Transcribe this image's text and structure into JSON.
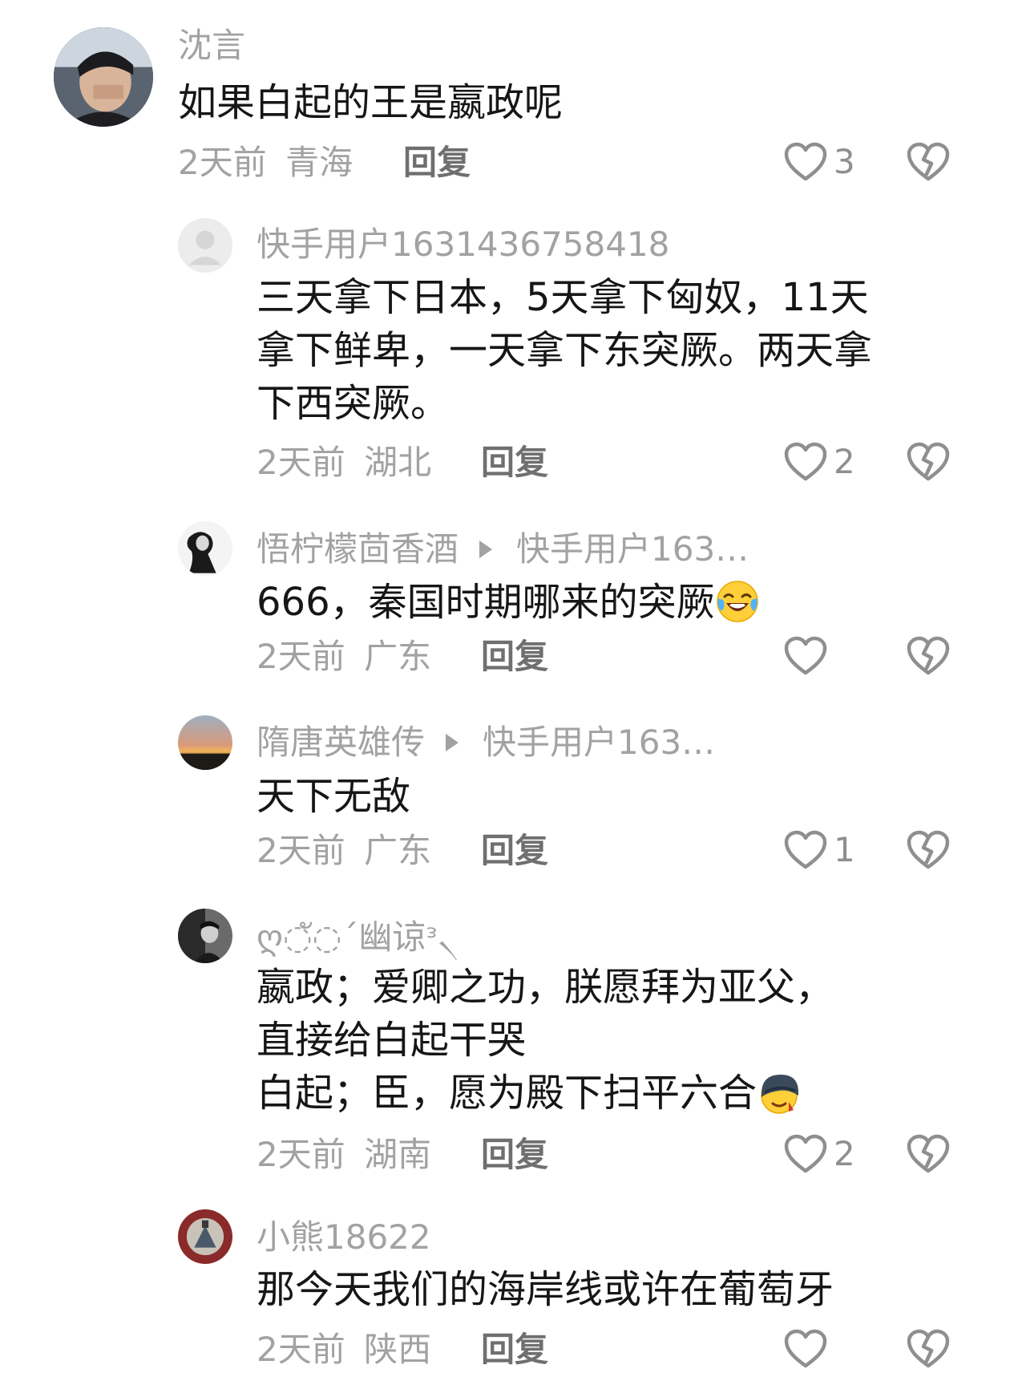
{
  "comments": [
    {
      "username": "沈言",
      "lines": [
        "如果白起的王是嬴政呢"
      ],
      "time": "2天前",
      "location": "青海",
      "reply_label": "回复",
      "likes": "3"
    },
    {
      "username": "快手用户1631436758418",
      "lines": [
        "三天拿下日本，5天拿下匈奴，11天",
        "拿下鲜卑，一天拿下东突厥。两天拿",
        "下西突厥。"
      ],
      "time": "2天前",
      "location": "湖北",
      "reply_label": "回复",
      "likes": "2"
    },
    {
      "username": "悟柠檬茴香酒",
      "reply_to": "快手用户163…",
      "lines": [
        "666，秦国时期哪来的突厥"
      ],
      "emoji": "laughing-crying-emoji",
      "time": "2天前",
      "location": "广东",
      "reply_label": "回复",
      "likes": ""
    },
    {
      "username": "隋唐英雄传",
      "reply_to": "快手用户163…",
      "lines": [
        "天下无敌"
      ],
      "time": "2天前",
      "location": "广东",
      "reply_label": "回复",
      "likes": "1"
    },
    {
      "username": "ღ◌ั◌ˊ幽谅ᵌ৲",
      "lines": [
        "嬴政；爱卿之功，朕愿拜为亚父，",
        "直接给白起干哭",
        "白起；臣，愿为殿下扫平六合"
      ],
      "emoji": "helmet-emoji",
      "time": "2天前",
      "location": "湖南",
      "reply_label": "回复",
      "likes": "2"
    },
    {
      "username": "小熊18622",
      "lines": [
        "那今天我们的海岸线或许在葡萄牙"
      ],
      "time": "2天前",
      "location": "陕西",
      "reply_label": "回复",
      "likes": ""
    }
  ],
  "icons": {
    "like": "heart-outline-icon",
    "dislike": "broken-heart-icon"
  },
  "colors": {
    "meta_text": "#a2a2a2",
    "reply_text": "#6f6f6f",
    "content_text": "#161616"
  }
}
